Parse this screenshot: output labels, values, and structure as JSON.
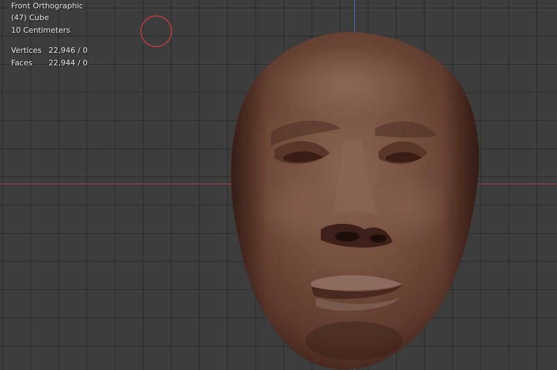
{
  "viewport": {
    "view_name": "Front Orthographic",
    "object_label": "(47) Cube",
    "scale_label": "10 Centimeters"
  },
  "stats": {
    "vertices_label": "Vertices",
    "vertices_value": "22,946 / 0",
    "faces_label": "Faces",
    "faces_value": "22,944 / 0"
  },
  "icons": {
    "cursor": "3d-cursor-icon"
  },
  "colors": {
    "background": "#3d3d3d",
    "x_axis": "#b3414a",
    "z_axis": "#3f6fae",
    "cursor": "#d23b3b",
    "mesh_base": "#6f4a3c"
  }
}
